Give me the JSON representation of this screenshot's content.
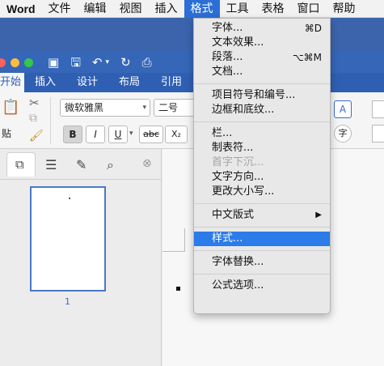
{
  "menubar": {
    "app": "Word",
    "items": [
      "文件",
      "编辑",
      "视图",
      "插入",
      "格式",
      "工具",
      "表格",
      "窗口",
      "帮助"
    ],
    "active_index": 4
  },
  "ribbon": {
    "tabs": [
      "开始",
      "插入",
      "设计",
      "布局",
      "引用"
    ],
    "selected_tab": "开始",
    "font_name": "微软雅黑",
    "font_size": "二号",
    "paste_label": "贴",
    "bold": "B",
    "italic": "I",
    "underline": "U",
    "strikethrough": "abc",
    "subscript": "X₂",
    "right_icons": [
      "A",
      "字"
    ]
  },
  "sidebar": {
    "page_number": "1"
  },
  "format_menu": {
    "groups": [
      [
        {
          "label": "字体...",
          "shortcut": "⌘D"
        },
        {
          "label": "文本效果...",
          "shortcut": ""
        },
        {
          "label": "段落...",
          "shortcut": "⌥⌘M"
        },
        {
          "label": "文档...",
          "shortcut": ""
        }
      ],
      [
        {
          "label": "项目符号和编号...",
          "shortcut": ""
        },
        {
          "label": "边框和底纹...",
          "shortcut": ""
        }
      ],
      [
        {
          "label": "栏...",
          "shortcut": ""
        },
        {
          "label": "制表符...",
          "shortcut": ""
        },
        {
          "label": "首字下沉...",
          "shortcut": "",
          "disabled": true
        },
        {
          "label": "文字方向...",
          "shortcut": ""
        },
        {
          "label": "更改大小写...",
          "shortcut": ""
        }
      ],
      [
        {
          "label": "中文版式",
          "shortcut": "▶"
        }
      ],
      [
        {
          "label": "样式...",
          "shortcut": "",
          "highlighted": true
        }
      ],
      [
        {
          "label": "字体替换...",
          "shortcut": ""
        }
      ],
      [
        {
          "label": "公式选项...",
          "shortcut": ""
        }
      ]
    ]
  },
  "colors": {
    "menu_highlight": "#2b7be8",
    "ribbon_blue": "#2f5fb3"
  }
}
